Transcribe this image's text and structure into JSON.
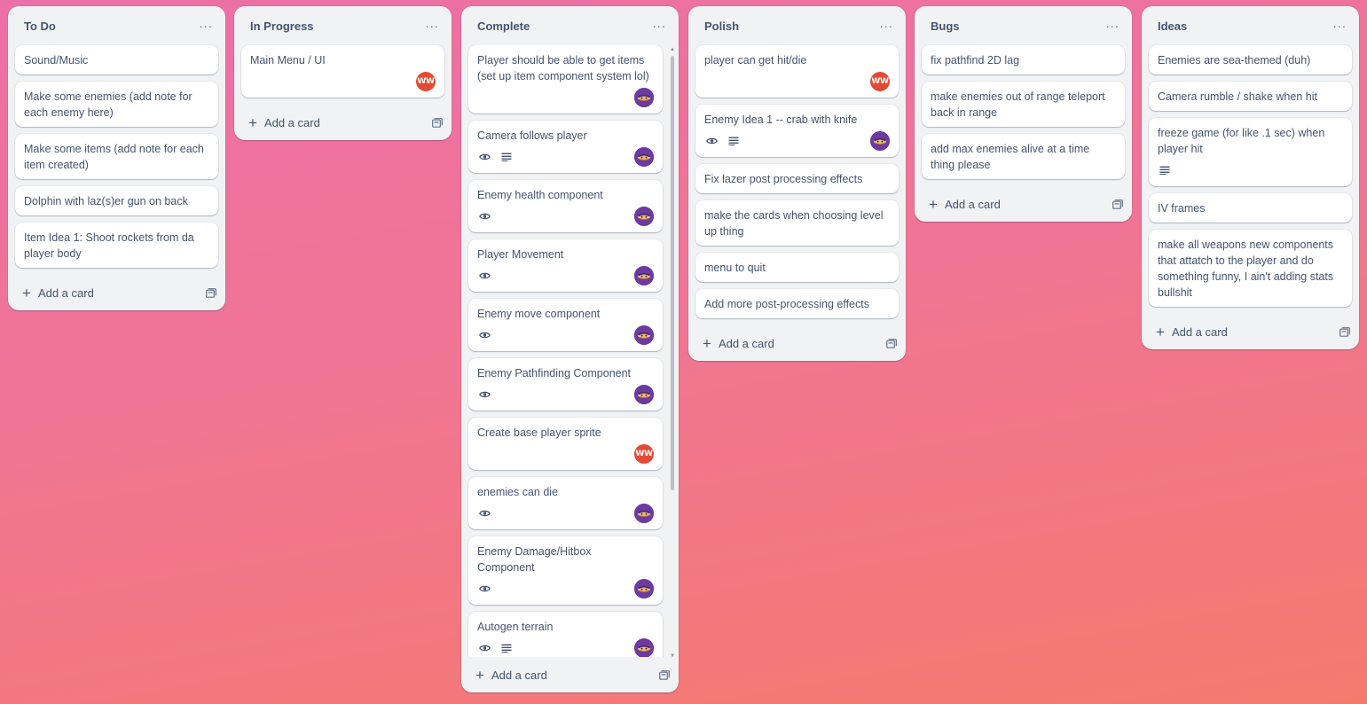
{
  "lists": [
    {
      "title": "To Do",
      "cards": [
        {
          "title": "Sound/Music"
        },
        {
          "title": "Make some enemies (add note for each enemy here)"
        },
        {
          "title": "Make some items (add note for each item created)"
        },
        {
          "title": "Dolphin with laz(s)er gun on back"
        },
        {
          "title": "Item Idea 1: Shoot rockets from da player body"
        }
      ],
      "add_label": "Add a card"
    },
    {
      "title": "In Progress",
      "cards": [
        {
          "title": "Main Menu / UI",
          "avatar": "WW"
        }
      ],
      "add_label": "Add a card"
    },
    {
      "title": "Complete",
      "cards": [
        {
          "title": "Player should be able to get items (set up item component system lol)",
          "avatar_icon": "member-avatar-image"
        },
        {
          "title": "Camera follows player",
          "badges": [
            "eye-icon",
            "description-icon"
          ],
          "avatar_icon": "member-avatar-image"
        },
        {
          "title": "Enemy health component",
          "badges": [
            "eye-icon"
          ],
          "avatar_icon": "member-avatar-image"
        },
        {
          "title": "Player Movement",
          "badges": [
            "eye-icon"
          ],
          "avatar_icon": "member-avatar-image"
        },
        {
          "title": "Enemy move component",
          "badges": [
            "eye-icon"
          ],
          "avatar_icon": "member-avatar-image"
        },
        {
          "title": "Enemy Pathfinding Component",
          "badges": [
            "eye-icon"
          ],
          "avatar_icon": "member-avatar-image"
        },
        {
          "title": "Create base player sprite",
          "avatar": "WW"
        },
        {
          "title": "enemies can die",
          "badges": [
            "eye-icon"
          ],
          "avatar_icon": "member-avatar-image"
        },
        {
          "title": "Enemy Damage/Hitbox Component",
          "badges": [
            "eye-icon"
          ],
          "avatar_icon": "member-avatar-image"
        },
        {
          "title": "Autogen terrain",
          "badges": [
            "eye-icon",
            "description-icon"
          ],
          "avatar_icon": "member-avatar-image"
        }
      ],
      "add_label": "Add a card"
    },
    {
      "title": "Polish",
      "cards": [
        {
          "title": "player can get hit/die",
          "avatar": "WW"
        },
        {
          "title": "Enemy Idea 1 -- crab with knife",
          "badges": [
            "eye-icon",
            "description-icon"
          ],
          "avatar_icon": "member-avatar-image"
        },
        {
          "title": "Fix lazer post processing effects"
        },
        {
          "title": "make the cards when choosing level up thing"
        },
        {
          "title": "menu to quit"
        },
        {
          "title": "Add more post-processing effects"
        }
      ],
      "add_label": "Add a card"
    },
    {
      "title": "Bugs",
      "cards": [
        {
          "title": "fix pathfind 2D lag"
        },
        {
          "title": "make enemies out of range teleport back in range"
        },
        {
          "title": "add max enemies alive at a time thing please"
        }
      ],
      "add_label": "Add a card"
    },
    {
      "title": "Ideas",
      "cards": [
        {
          "title": "Enemies are sea-themed (duh)"
        },
        {
          "title": "Camera rumble / shake when hit"
        },
        {
          "title": "freeze game (for like .1 sec) when player hit",
          "badges": [
            "description-icon"
          ]
        },
        {
          "title": "IV frames"
        },
        {
          "title": "make all weapons new components that attatch to the player and do something funny, I ain't adding stats bullshit"
        }
      ],
      "add_label": "Add a card"
    }
  ],
  "icons": {
    "list_menu": "more-options-icon",
    "add": "plus-icon",
    "template": "create-from-template-icon"
  },
  "colors": {
    "list_bg": "#f1f2f4",
    "card_bg": "#ffffff",
    "avatar_ww": "#e34935",
    "avatar_member": "#6c3aa0"
  }
}
